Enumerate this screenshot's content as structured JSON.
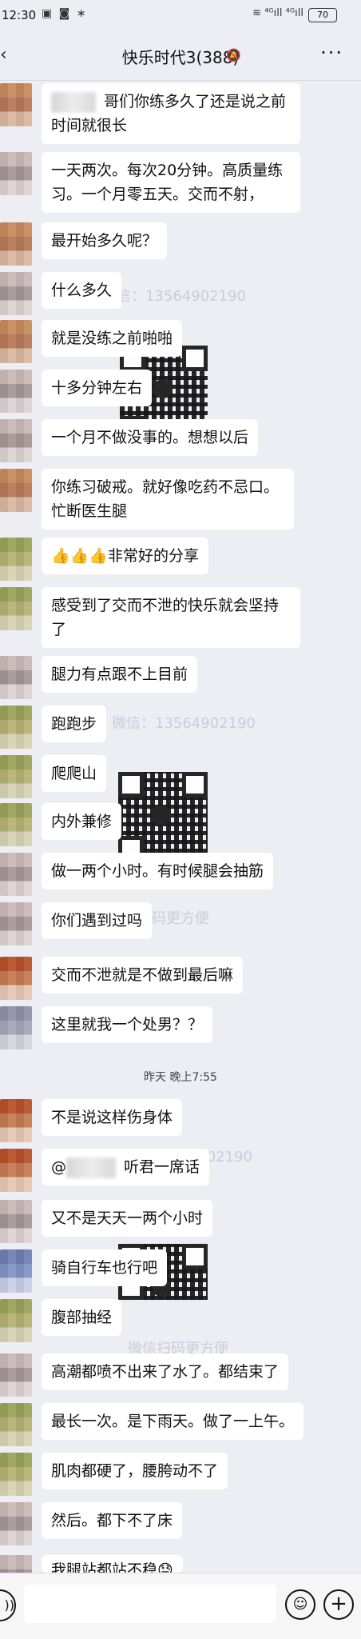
{
  "status_bar": {
    "time": "12:30",
    "left_icons": "▣ ◙ ∗",
    "right_icons": "≋ ⁴ᴳıll ⁴ᴳıll",
    "battery": "70"
  },
  "header": {
    "back_icon": "chevron-left",
    "title": "快乐时代3(388)",
    "mute_icon": "bell-off",
    "more_label": "···"
  },
  "messages": [
    {
      "text": "哥们你练多久了还是说之前时间就很长",
      "has_mention_blur": true
    },
    {
      "text": "一天两次。每次20分钟。高质量练习。一个月零五天。交而不射，"
    },
    {
      "text": "最开始多久呢？"
    },
    {
      "text": "什么多久"
    },
    {
      "text": "就是没练之前啪啪"
    },
    {
      "text": "十多分钟左右"
    },
    {
      "text": "一个月不做没事的。想想以后"
    },
    {
      "text": "你练习破戒。就好像吃药不忌口。忙断医生腿"
    },
    {
      "text": "👍👍👍非常好的分享"
    },
    {
      "text": "感受到了交而不泄的快乐就会坚持了"
    },
    {
      "text": "腿力有点跟不上目前"
    },
    {
      "text": "跑跑步"
    },
    {
      "text": "爬爬山"
    },
    {
      "text": "内外兼修"
    },
    {
      "text": "做一两个小时。有时候腿会抽筋"
    },
    {
      "text": "你们遇到过吗"
    },
    {
      "text": "交而不泄就是不做到最后嘛"
    },
    {
      "text": "这里就我一个处男？？"
    },
    {
      "text": "不是说这样伤身体"
    },
    {
      "text_prefix": "@",
      "text": "听君一席话",
      "has_mention_blur": true
    },
    {
      "text": "又不是天天一两个小时"
    },
    {
      "text": "骑自行车也行吧"
    },
    {
      "text": "腹部抽经"
    },
    {
      "text": "高潮都喷不出来了水了。都结束了"
    },
    {
      "text": "最长一次。是下雨天。做了一上午。"
    },
    {
      "text": "肌肉都硬了，腰胯动不了"
    },
    {
      "text": "然后。都下不了床"
    },
    {
      "text": "我腿站都站不稳😓"
    }
  ],
  "time_divider": "昨天 晚上7:55",
  "watermarks": [
    "信：13564902190",
    "微信：13564902190",
    "码更方便",
    "微信：13564902190",
    "微信扫码更方便"
  ],
  "input_bar": {
    "voice_icon": "voice",
    "emoji_icon": "emoji",
    "plus_icon": "plus"
  }
}
